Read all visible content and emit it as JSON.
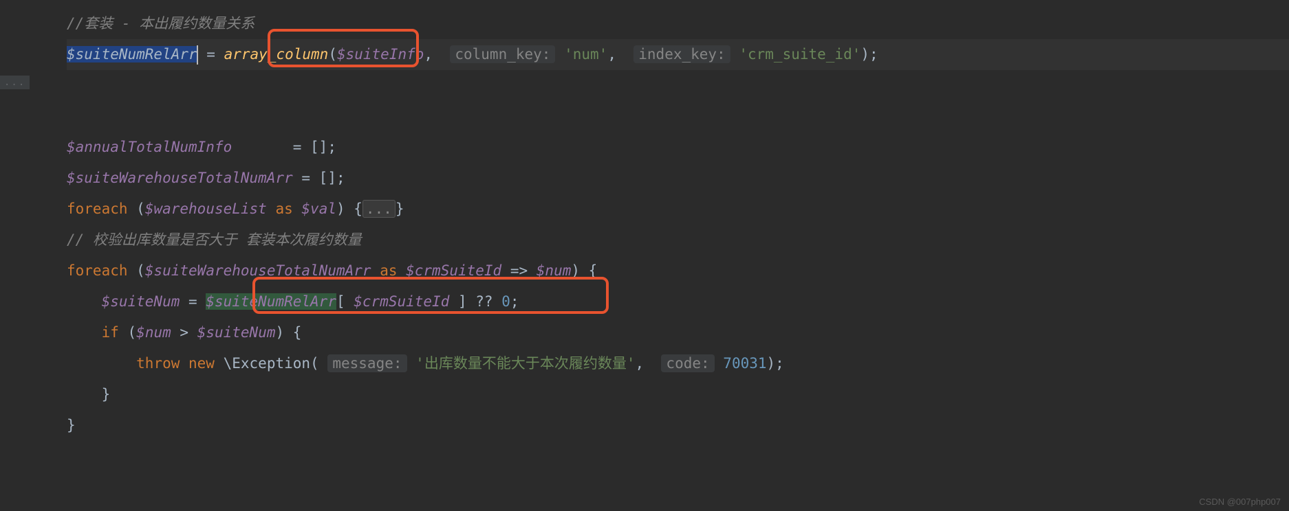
{
  "watermark": "CSDN @007php007",
  "gutter_fold": "...",
  "code": {
    "l1_comment": "//套装 - 本出履约数量关系",
    "l2": {
      "var1": "$suiteNumRelArr",
      "eq": " = ",
      "func": "array_column",
      "open": "(",
      "arg1": "$suiteInfo",
      "comma1": ", ",
      "hint1": "column_key:",
      "str1": "'num'",
      "comma2": ", ",
      "hint2": "index_key:",
      "str2": "'crm_suite_id'",
      "close": ");"
    },
    "l4": {
      "var": "$annualTotalNumInfo",
      "pad": "       = ",
      "val": "[]",
      "semi": ";"
    },
    "l5": {
      "var": "$suiteWarehouseTotalNumArr",
      "eq": " = ",
      "val": "[]",
      "semi": ";"
    },
    "l6": {
      "kw": "foreach ",
      "open": "(",
      "var1": "$warehouseList",
      "as": " as ",
      "var2": "$val",
      "close": ") {",
      "fold": "...",
      "end": "}"
    },
    "l7_comment": "// 校验出库数量是否大于 套装本次履约数量",
    "l8": {
      "kw": "foreach ",
      "open": "(",
      "var1": "$suiteWarehouseTotalNumArr",
      "as": " as ",
      "var2": "$crmSuiteId",
      "arrow": " => ",
      "var3": "$num",
      "close": ") {"
    },
    "l9": {
      "indent": "    ",
      "var1": "$suiteNum",
      "eq": " = ",
      "var2": "$suiteNumRelArr",
      "open": "[ ",
      "var3": "$crmSuiteId",
      "close": " ] ",
      "coalesce": "?? ",
      "num": "0",
      "semi": ";"
    },
    "l10": {
      "indent": "    ",
      "kw": "if ",
      "open": "(",
      "var1": "$num",
      "op": " > ",
      "var2": "$suiteNum",
      "close": ") {"
    },
    "l11": {
      "indent": "        ",
      "kw1": "throw ",
      "kw2": "new ",
      "backslash": "\\",
      "class": "Exception",
      "open": "(",
      "hint1": "message:",
      "str": "'出库数量不能大于本次履约数量'",
      "comma": ", ",
      "hint2": "code:",
      "num": "70031",
      "close": ");"
    },
    "l12": {
      "indent": "    ",
      "brace": "}"
    },
    "l13": {
      "brace": "}"
    }
  }
}
